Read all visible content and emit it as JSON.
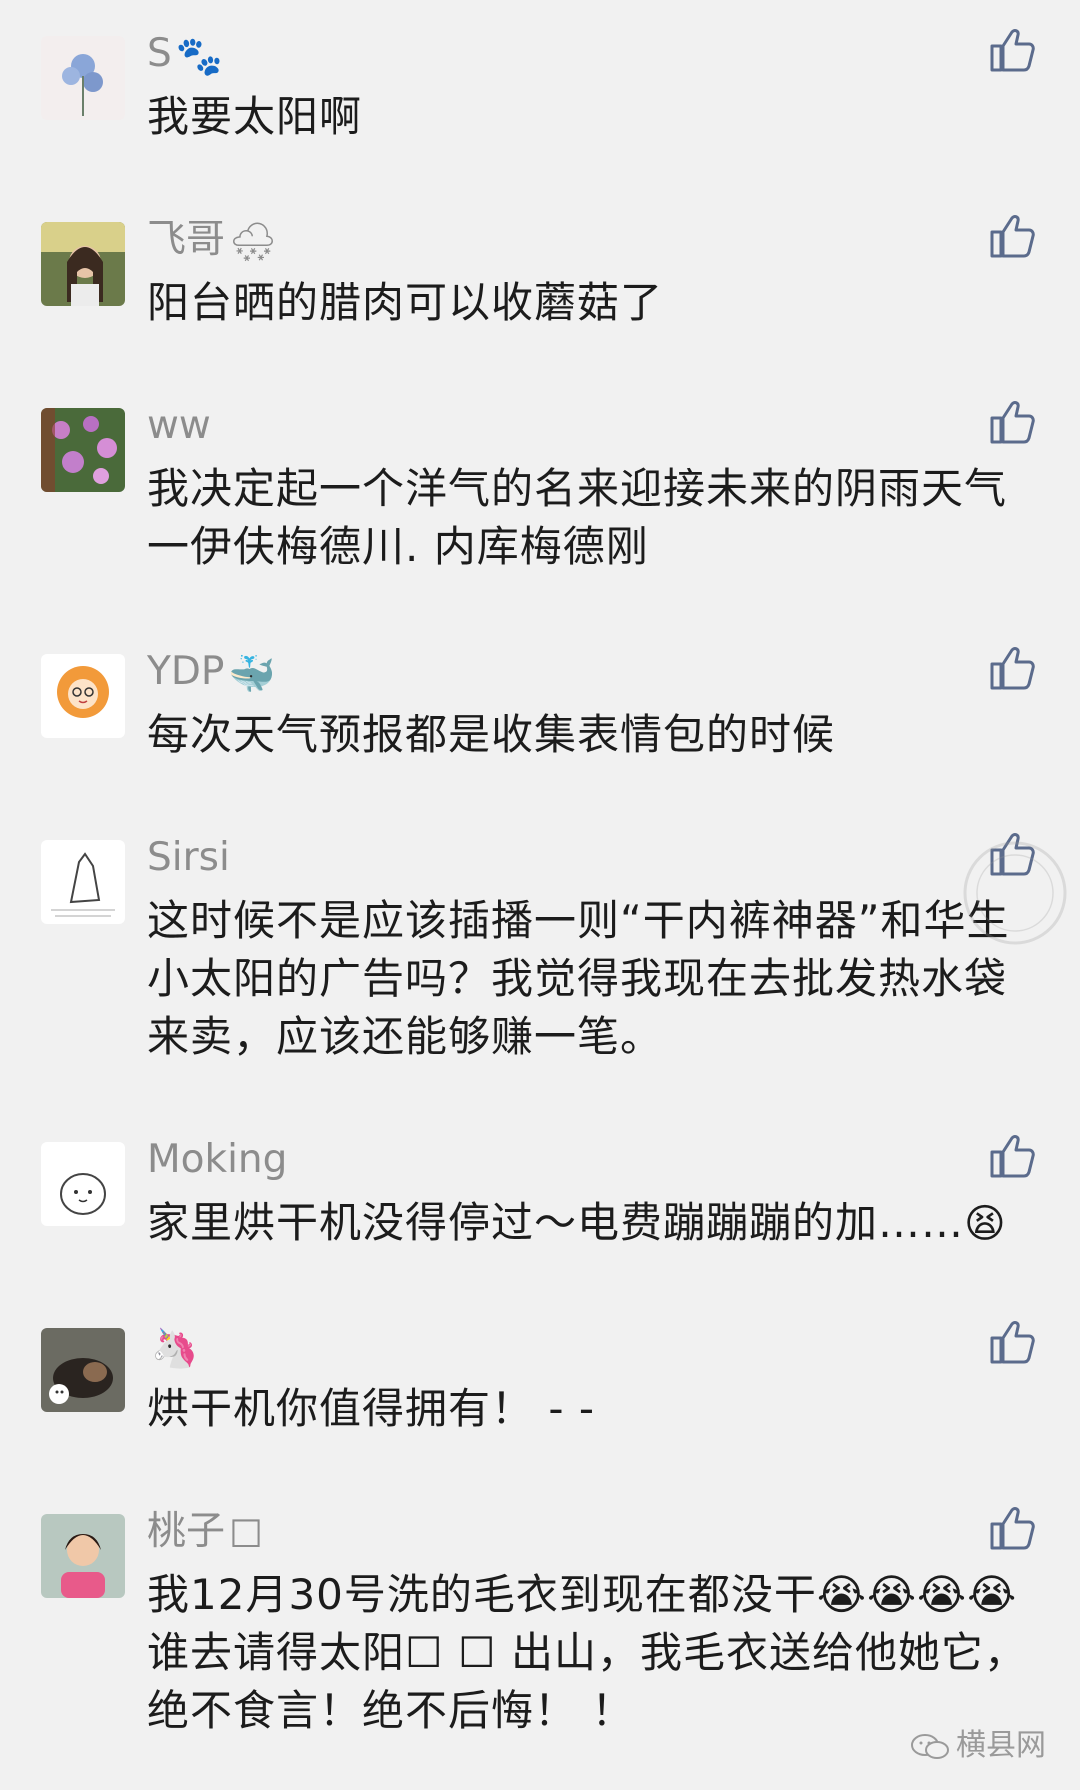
{
  "comments": [
    {
      "nickname": "S",
      "nick_emoji": "🐾",
      "text": "我要太阳啊"
    },
    {
      "nickname": "飞哥",
      "nick_emoji": "🌨",
      "text": "阳台晒的腊肉可以收蘑菇了"
    },
    {
      "nickname": "ww",
      "nick_emoji": "",
      "text": "我决定起一个洋气的名来迎接未来的阴雨天气一伊伕梅德川. 内库梅德刚"
    },
    {
      "nickname": "YDP",
      "nick_emoji": "🐳",
      "text": "每次天气预报都是收集表情包的时候"
    },
    {
      "nickname": "Sirsi",
      "nick_emoji": "",
      "text": "这时候不是应该插播一则“干内裤神器”和华生小太阳的广告吗？我觉得我现在去批发热水袋来卖，应该还能够赚一笔。"
    },
    {
      "nickname": "Moking",
      "nick_emoji": "",
      "text": "家里烘干机没得停过～电费蹦蹦蹦的加……",
      "text_emoji": "😫"
    },
    {
      "nickname": "",
      "nick_emoji": "🦄",
      "text": "烘干机你值得拥有！ - -"
    },
    {
      "nickname": "桃子",
      "nick_emoji": "☐",
      "text": "我12月30号洗的毛衣到现在都没干😭😭😭😭谁去请得太阳☐ ☐ 出山，我毛衣送给他她它，绝不食言！绝不后悔！ ！"
    }
  ],
  "footer": {
    "brand": "横县网",
    "icon": "wechat-icon"
  },
  "colors": {
    "background": "#f1f1f1",
    "nickname": "#8c8c8c",
    "text": "#1c1c1c",
    "like": "#5b6b8c"
  }
}
